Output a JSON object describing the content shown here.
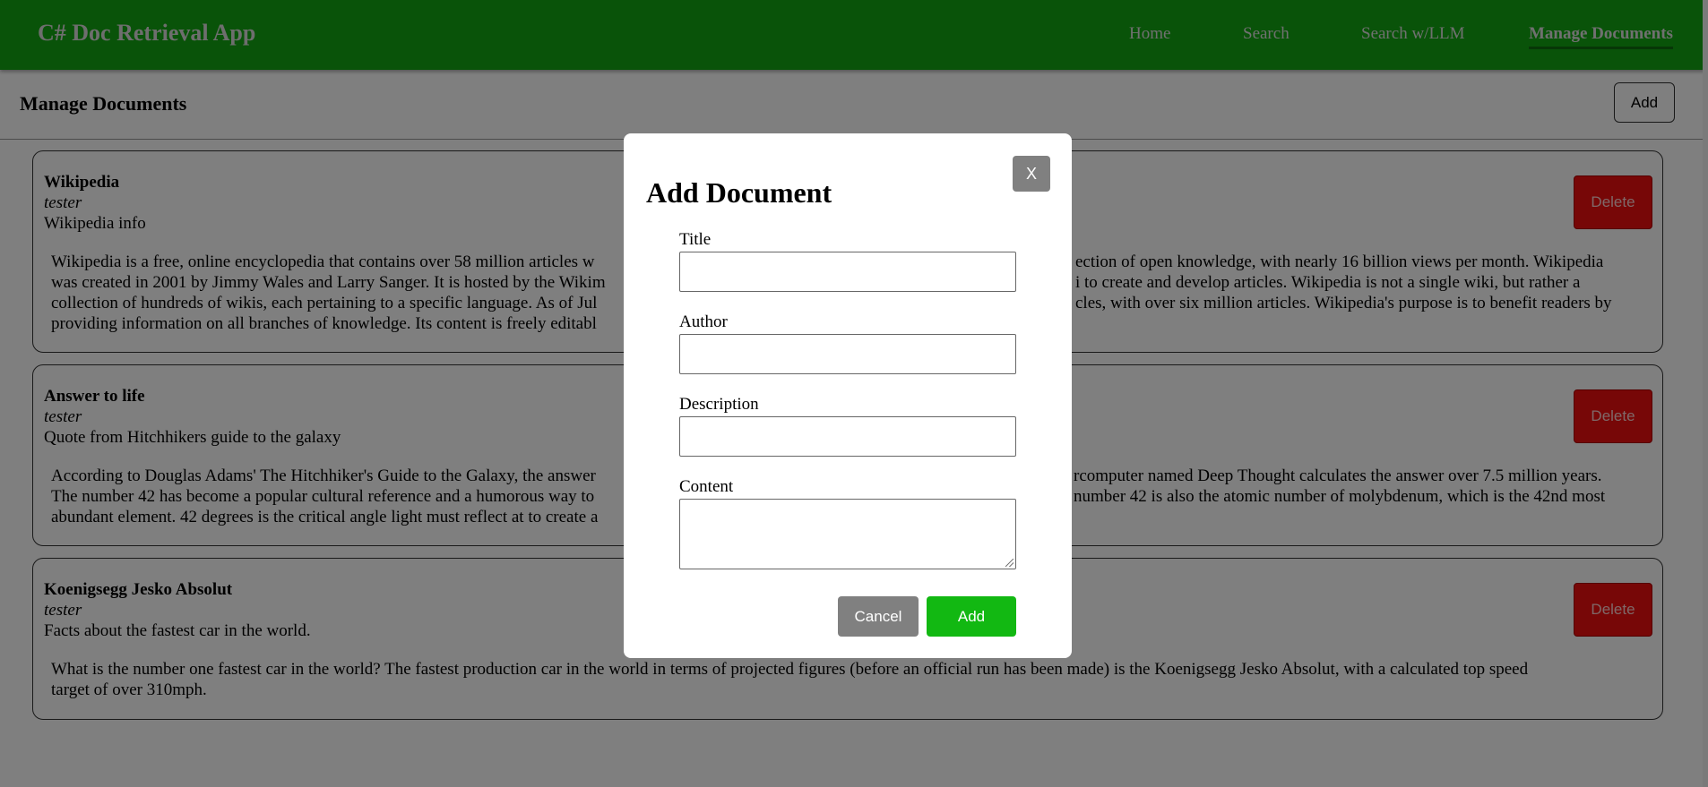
{
  "app": {
    "title": "C# Doc Retrieval App"
  },
  "nav": {
    "items": [
      {
        "label": "Home",
        "active": false
      },
      {
        "label": "Search",
        "active": false
      },
      {
        "label": "Search w/LLM",
        "active": false
      },
      {
        "label": "Manage Documents",
        "active": true
      }
    ]
  },
  "page": {
    "title": "Manage Documents",
    "add_label": "Add"
  },
  "documents": [
    {
      "title": "Wikipedia",
      "author": "tester",
      "description": "Wikipedia info",
      "content_lines": [
        "Wikipedia is a free, online encyclopedia that contains over 58 million articles w",
        "was created in 2001 by Jimmy Wales and Larry Sanger. It is hosted by the Wikim",
        "collection of hundreds of wikis, each pertaining to a specific language. As of Jul",
        "providing information on all branches of knowledge. Its content is freely editabl"
      ],
      "content_lines_right": [
        "ection of open knowledge, with nearly 16 billion views per month. Wikipedia",
        "i to create and develop articles. Wikipedia is not a single wiki, but rather a",
        "cles, with over six million articles. Wikipedia's purpose is to benefit readers by",
        ""
      ],
      "delete_label": "Delete"
    },
    {
      "title": "Answer to life",
      "author": "tester",
      "description": "Quote from Hitchhikers guide to the galaxy",
      "content_lines": [
        "According to Douglas Adams' The Hitchhiker's Guide to the Galaxy, the answer",
        "The number 42 has become a popular cultural reference and a humorous way to",
        "abundant element. 42 degrees is the critical angle light must reflect at to create a"
      ],
      "content_lines_right": [
        "rcomputer named Deep Thought calculates the answer over 7.5 million years.",
        "number 42 is also the atomic number of molybdenum, which is the 42nd most",
        ""
      ],
      "delete_label": "Delete"
    },
    {
      "title": "Koenigsegg Jesko Absolut",
      "author": "tester",
      "description": "Facts about the fastest car in the world.",
      "content_lines": [
        "What is the number one fastest car in the world? The fastest production car in the world in terms of projected figures (before an official run has been made) is the Koenigsegg Jesko Absolut, with a calculated top speed",
        "target of over 310mph."
      ],
      "content_lines_right": [],
      "delete_label": "Delete"
    }
  ],
  "modal": {
    "close_label": "X",
    "title": "Add Document",
    "fields": {
      "title_label": "Title",
      "title_value": "",
      "author_label": "Author",
      "author_value": "",
      "description_label": "Description",
      "description_value": "",
      "content_label": "Content",
      "content_value": ""
    },
    "cancel_label": "Cancel",
    "submit_label": "Add"
  },
  "colors": {
    "navbar": "#12a712",
    "delete": "#ee0e0e",
    "submit": "#12b812",
    "neutral_button": "#808080"
  }
}
